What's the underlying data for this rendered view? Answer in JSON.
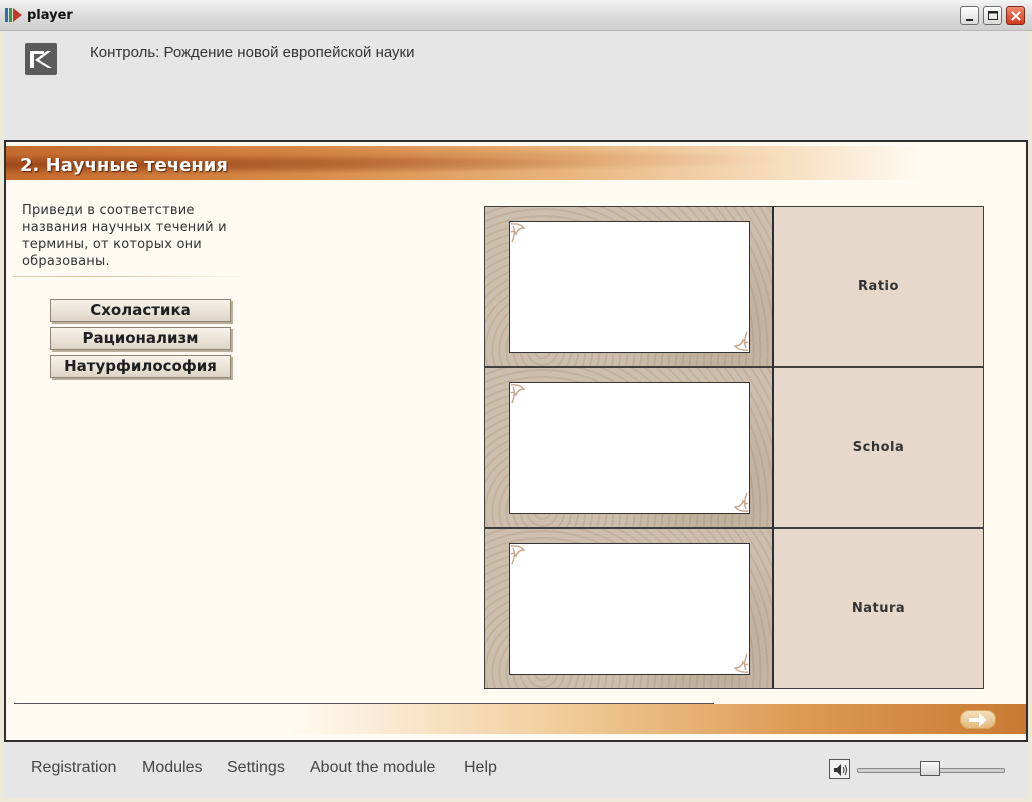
{
  "window": {
    "title": "player"
  },
  "header": {
    "course_title": "Контроль: Рождение новой европейской науки"
  },
  "section": {
    "title": "2. Научные течения",
    "instruction": "Приведи в соответствие\nназвания  научных течений  и\nтермины, от которых они\nобразованы."
  },
  "terms": [
    {
      "label": "Схоластика"
    },
    {
      "label": "Рационализм"
    },
    {
      "label": "Натурфилософия"
    }
  ],
  "matches": [
    {
      "word": "Ratio",
      "slot": ""
    },
    {
      "word": "Schola",
      "slot": ""
    },
    {
      "word": "Natura",
      "slot": ""
    }
  ],
  "footer": {
    "nav": [
      {
        "label": "Registration"
      },
      {
        "label": "Modules"
      },
      {
        "label": "Settings"
      },
      {
        "label": "About the module"
      },
      {
        "label": "Help"
      }
    ],
    "volume_level": 0.5
  },
  "icons": {
    "app": "player-app-icon",
    "logo": "k-logo",
    "next": "arrow-right-icon",
    "speaker": "speaker-icon"
  },
  "colors": {
    "banner_accent": "#c46a2d",
    "title_text": "#ffffff",
    "word_cell_bg": "#e6d9cb"
  }
}
